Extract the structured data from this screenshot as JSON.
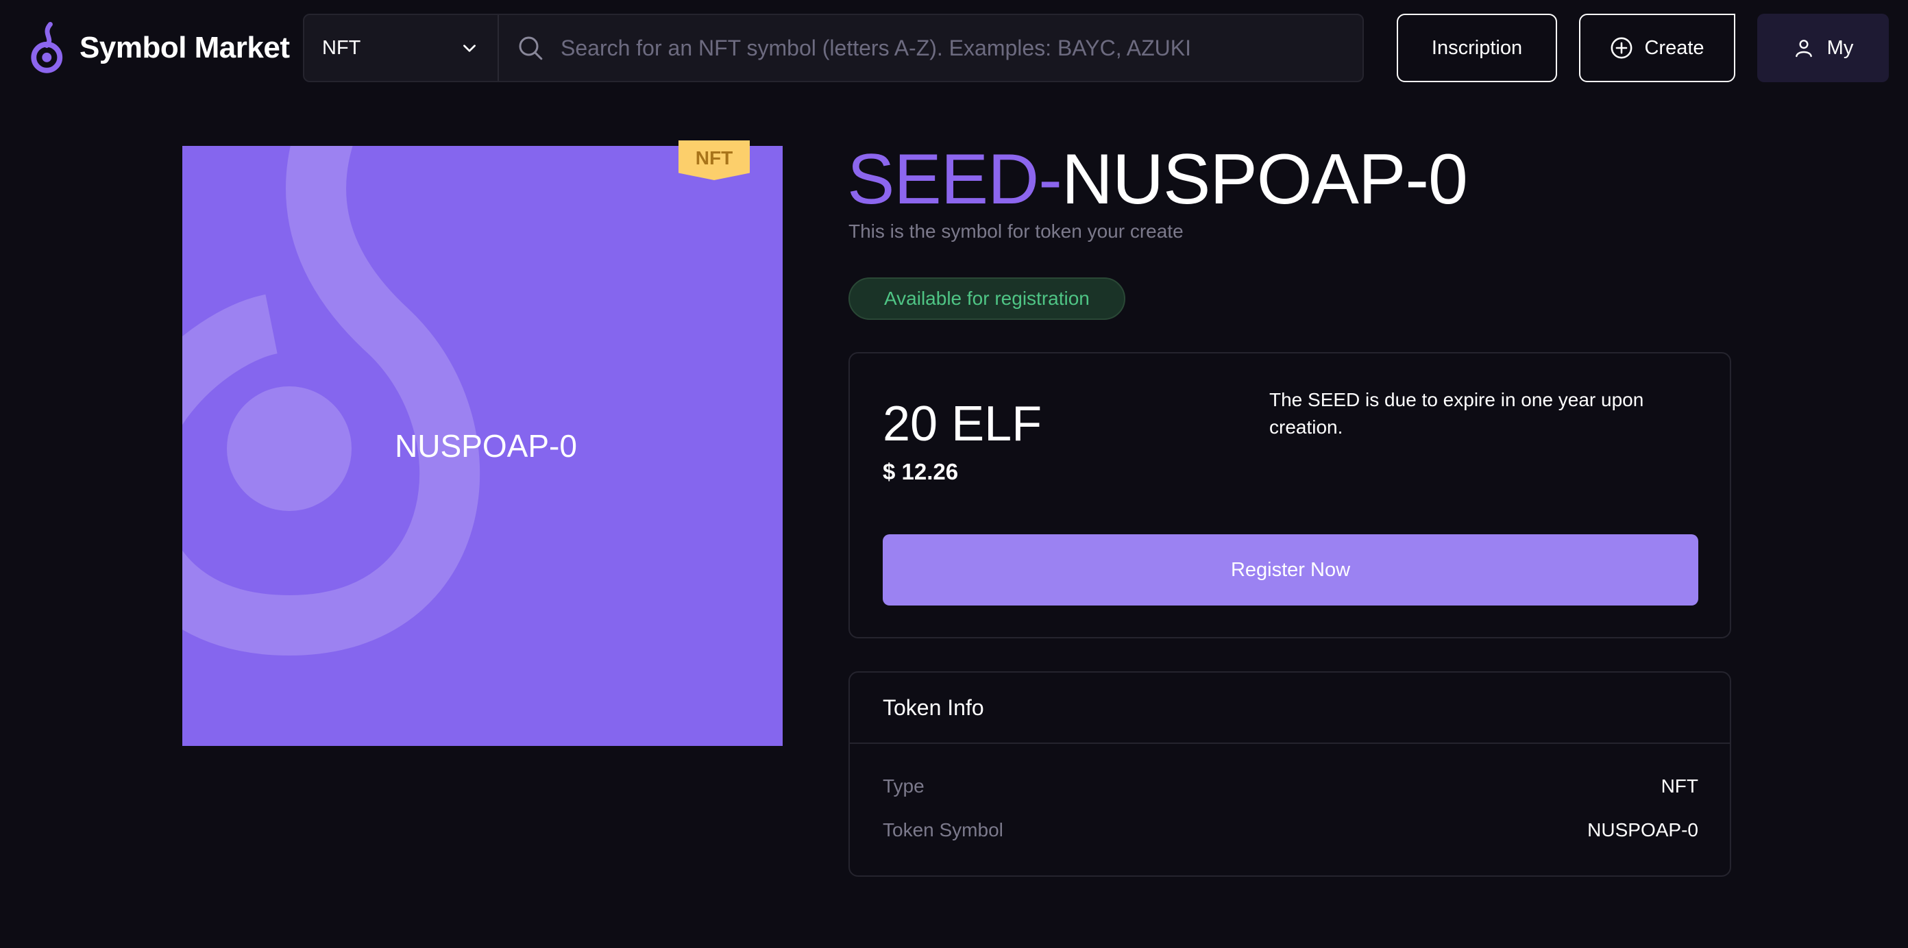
{
  "header": {
    "brand": "Symbol Market",
    "type_select": "NFT",
    "search_placeholder": "Search for an NFT symbol (letters A-Z). Examples: BAYC, AZUKI",
    "inscription_label": "Inscription",
    "create_label": "Create",
    "my_label": "My"
  },
  "token": {
    "image_label": "NUSPOAP-0",
    "badge": "NFT",
    "title_prefix": "SEED-",
    "title_symbol": "NUSPOAP-0",
    "subtitle": "This is the symbol for token your create",
    "status": "Available for registration"
  },
  "price": {
    "elf": "20 ELF",
    "usd": "$ 12.26",
    "expire_note": "The SEED is due to expire in one year upon creation.",
    "register_label": "Register Now"
  },
  "token_info": {
    "title": "Token Info",
    "rows": [
      {
        "key": "Type",
        "value": "NFT"
      },
      {
        "key": "Token Symbol",
        "value": "NUSPOAP-0"
      }
    ]
  },
  "colors": {
    "accent": "#8566ee",
    "status_green": "#4fc585",
    "badge_yellow": "#fccf6b"
  },
  "icons": [
    "logo-icon",
    "chevron-down-icon",
    "search-icon",
    "plus-circle-icon",
    "user-icon"
  ]
}
